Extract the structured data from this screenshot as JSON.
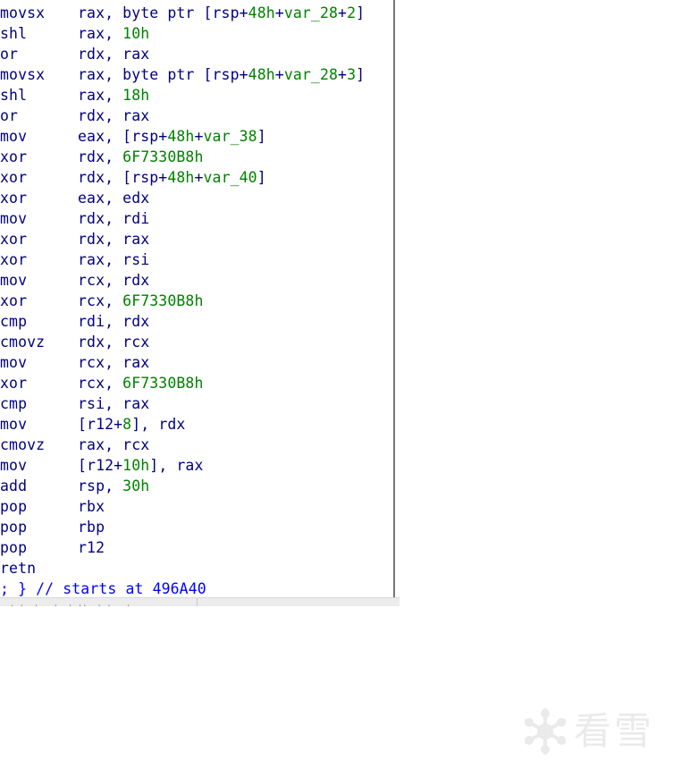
{
  "disassembly": {
    "lines": [
      {
        "mnemonic": "movsx",
        "parts": [
          {
            "t": "rax, byte ptr [rsp+",
            "c": "op"
          },
          {
            "t": "48h",
            "c": "num"
          },
          {
            "t": "+",
            "c": "op"
          },
          {
            "t": "var_28",
            "c": "num"
          },
          {
            "t": "+",
            "c": "op"
          },
          {
            "t": "2",
            "c": "num"
          },
          {
            "t": "]",
            "c": "op"
          }
        ]
      },
      {
        "mnemonic": "shl",
        "parts": [
          {
            "t": "rax, ",
            "c": "op"
          },
          {
            "t": "10h",
            "c": "num"
          }
        ]
      },
      {
        "mnemonic": "or",
        "parts": [
          {
            "t": "rdx, rax",
            "c": "op"
          }
        ]
      },
      {
        "mnemonic": "movsx",
        "parts": [
          {
            "t": "rax, byte ptr [rsp+",
            "c": "op"
          },
          {
            "t": "48h",
            "c": "num"
          },
          {
            "t": "+",
            "c": "op"
          },
          {
            "t": "var_28",
            "c": "num"
          },
          {
            "t": "+",
            "c": "op"
          },
          {
            "t": "3",
            "c": "num"
          },
          {
            "t": "]",
            "c": "op"
          }
        ]
      },
      {
        "mnemonic": "shl",
        "parts": [
          {
            "t": "rax, ",
            "c": "op"
          },
          {
            "t": "18h",
            "c": "num"
          }
        ]
      },
      {
        "mnemonic": "or",
        "parts": [
          {
            "t": "rdx, rax",
            "c": "op"
          }
        ]
      },
      {
        "mnemonic": "mov",
        "parts": [
          {
            "t": "eax, [rsp+",
            "c": "op"
          },
          {
            "t": "48h",
            "c": "num"
          },
          {
            "t": "+",
            "c": "op"
          },
          {
            "t": "var_38",
            "c": "num"
          },
          {
            "t": "]",
            "c": "op"
          }
        ]
      },
      {
        "mnemonic": "xor",
        "parts": [
          {
            "t": "rdx, ",
            "c": "op"
          },
          {
            "t": "6F7330B8h",
            "c": "num"
          }
        ]
      },
      {
        "mnemonic": "xor",
        "parts": [
          {
            "t": "rdx, [rsp+",
            "c": "op"
          },
          {
            "t": "48h",
            "c": "num"
          },
          {
            "t": "+",
            "c": "op"
          },
          {
            "t": "var_40",
            "c": "num"
          },
          {
            "t": "]",
            "c": "op"
          }
        ]
      },
      {
        "mnemonic": "xor",
        "parts": [
          {
            "t": "eax, edx",
            "c": "op"
          }
        ]
      },
      {
        "mnemonic": "mov",
        "parts": [
          {
            "t": "rdx, rdi",
            "c": "op"
          }
        ]
      },
      {
        "mnemonic": "xor",
        "parts": [
          {
            "t": "rdx, rax",
            "c": "op"
          }
        ]
      },
      {
        "mnemonic": "xor",
        "parts": [
          {
            "t": "rax, rsi",
            "c": "op"
          }
        ]
      },
      {
        "mnemonic": "mov",
        "parts": [
          {
            "t": "rcx, rdx",
            "c": "op"
          }
        ]
      },
      {
        "mnemonic": "xor",
        "parts": [
          {
            "t": "rcx, ",
            "c": "op"
          },
          {
            "t": "6F7330B8h",
            "c": "num"
          }
        ]
      },
      {
        "mnemonic": "cmp",
        "parts": [
          {
            "t": "rdi, rdx",
            "c": "op"
          }
        ]
      },
      {
        "mnemonic": "cmovz",
        "parts": [
          {
            "t": "rdx, rcx",
            "c": "op"
          }
        ]
      },
      {
        "mnemonic": "mov",
        "parts": [
          {
            "t": "rcx, rax",
            "c": "op"
          }
        ]
      },
      {
        "mnemonic": "xor",
        "parts": [
          {
            "t": "rcx, ",
            "c": "op"
          },
          {
            "t": "6F7330B8h",
            "c": "num"
          }
        ]
      },
      {
        "mnemonic": "cmp",
        "parts": [
          {
            "t": "rsi, rax",
            "c": "op"
          }
        ]
      },
      {
        "mnemonic": "mov",
        "parts": [
          {
            "t": "[r12+",
            "c": "op"
          },
          {
            "t": "8",
            "c": "num"
          },
          {
            "t": "], rdx",
            "c": "op"
          }
        ]
      },
      {
        "mnemonic": "cmovz",
        "parts": [
          {
            "t": "rax, rcx",
            "c": "op"
          }
        ]
      },
      {
        "mnemonic": "mov",
        "parts": [
          {
            "t": "[r12+",
            "c": "op"
          },
          {
            "t": "10h",
            "c": "num"
          },
          {
            "t": "], rax",
            "c": "op"
          }
        ]
      },
      {
        "mnemonic": "add",
        "parts": [
          {
            "t": "rsp, ",
            "c": "op"
          },
          {
            "t": "30h",
            "c": "num"
          }
        ]
      },
      {
        "mnemonic": "pop",
        "parts": [
          {
            "t": "rbx",
            "c": "op"
          }
        ]
      },
      {
        "mnemonic": "pop",
        "parts": [
          {
            "t": "rbp",
            "c": "op"
          }
        ]
      },
      {
        "mnemonic": "pop",
        "parts": [
          {
            "t": "r12",
            "c": "op"
          }
        ]
      },
      {
        "mnemonic": "retn",
        "parts": []
      }
    ],
    "comment": "; } // starts at 496A40"
  },
  "scrollbar": {
    "cut_text": "  . ,  ,   ,  , ,,  , ,   ,"
  },
  "watermark": {
    "text": "看雪",
    "icon": "snowflake-icon"
  },
  "colors": {
    "text": "#000080",
    "number": "#008000",
    "comment": "#0000ff"
  }
}
